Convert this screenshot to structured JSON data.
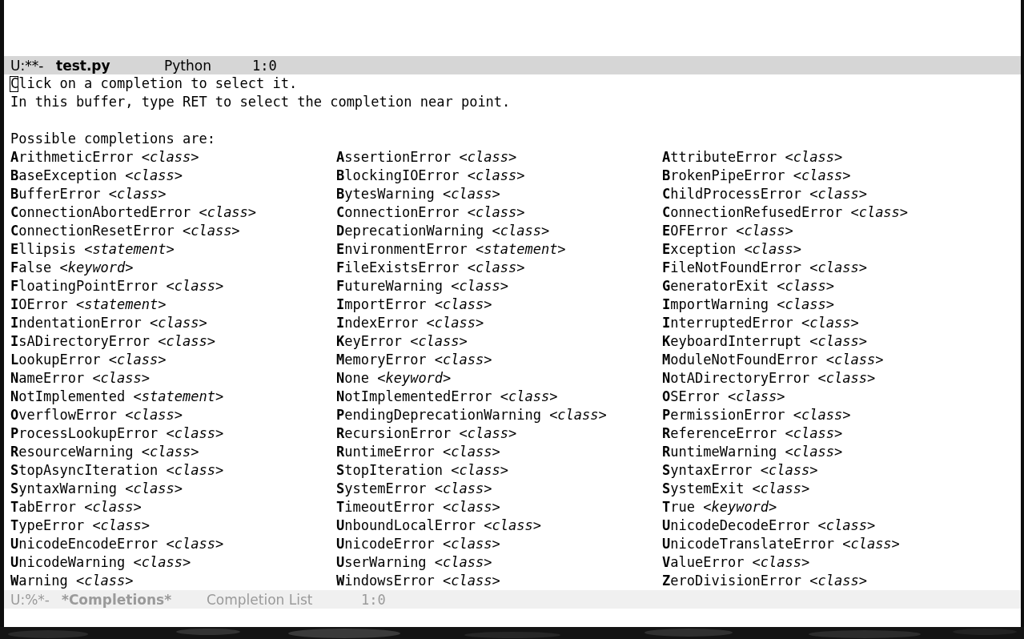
{
  "top_mode_line": {
    "active": true,
    "status": "U:**-",
    "buffer": "test.py",
    "mode": "Python",
    "position": "1:0"
  },
  "help_lines": [
    {
      "text": "Click on a completion to select it.",
      "cursor": true
    },
    {
      "text": "In this buffer, type RET to select the completion near point.",
      "cursor": false
    }
  ],
  "heading": "Possible completions are:",
  "completions": [
    "**A**rithmeticError *<class>*",
    "**A**ssertionError *<class>*",
    "**A**ttributeError *<class>*",
    "**B**aseException *<class>*",
    "**B**lockingIOError *<class>*",
    "**B**rokenPipeError *<class>*",
    "**B**ufferError *<class>*",
    "**B**ytesWarning *<class>*",
    "**C**hildProcessError *<class>*",
    "**C**onnectionAbortedError *<class>*",
    "**C**onnectionError *<class>*",
    "**C**onnectionRefusedError *<class>*",
    "**C**onnectionResetError *<class>*",
    "**D**eprecationWarning *<class>*",
    "**E**OFError *<class>*",
    "**E**llipsis *<statement>*",
    "**E**nvironmentError *<statement>*",
    "**E**xception *<class>*",
    "**F**alse *<keyword>*",
    "**F**ileExistsError *<class>*",
    "**F**ileNotFoundError *<class>*",
    "**F**loatingPointError *<class>*",
    "**F**utureWarning *<class>*",
    "**G**eneratorExit *<class>*",
    "**I**OError *<statement>*",
    "**I**mportError *<class>*",
    "**I**mportWarning *<class>*",
    "**I**ndentationError *<class>*",
    "**I**ndexError *<class>*",
    "**I**nterruptedError *<class>*",
    "**I**sADirectoryError *<class>*",
    "**K**eyError *<class>*",
    "**K**eyboardInterrupt *<class>*",
    "**L**ookupError *<class>*",
    "**M**emoryError *<class>*",
    "**M**oduleNotFoundError *<class>*",
    "**N**ameError *<class>*",
    "**N**one *<keyword>*",
    "**N**otADirectoryError *<class>*",
    "**N**otImplemented *<statement>*",
    "**N**otImplementedError *<class>*",
    "**O**SError *<class>*",
    "**O**verflowError *<class>*",
    "**P**endingDeprecationWarning *<class>*",
    "**P**ermissionError *<class>*",
    "**P**rocessLookupError *<class>*",
    "**R**ecursionError *<class>*",
    "**R**eferenceError *<class>*",
    "**R**esourceWarning *<class>*",
    "**R**untimeError *<class>*",
    "**R**untimeWarning *<class>*",
    "**S**topAsyncIteration *<class>*",
    "**S**topIteration *<class>*",
    "**S**yntaxError *<class>*",
    "**S**yntaxWarning *<class>*",
    "**S**ystemError *<class>*",
    "**S**ystemExit *<class>*",
    "**T**abError *<class>*",
    "**T**imeoutError *<class>*",
    "**T**rue *<keyword>*",
    "**T**ypeError *<class>*",
    "**U**nboundLocalError *<class>*",
    "**U**nicodeDecodeError *<class>*",
    "**U**nicodeEncodeError *<class>*",
    "**U**nicodeError *<class>*",
    "**U**nicodeTranslateError *<class>*",
    "**U**nicodeWarning *<class>*",
    "**U**serWarning *<class>*",
    "**V**alueError *<class>*",
    "**W**arning *<class>*",
    "**W**indowsError *<class>*",
    "**Z**eroDivisionError *<class>*"
  ],
  "bottom_mode_line": {
    "active": false,
    "status": "U:%*-",
    "buffer": "*Completions*",
    "mode": "Completion List",
    "position": "1:0"
  }
}
